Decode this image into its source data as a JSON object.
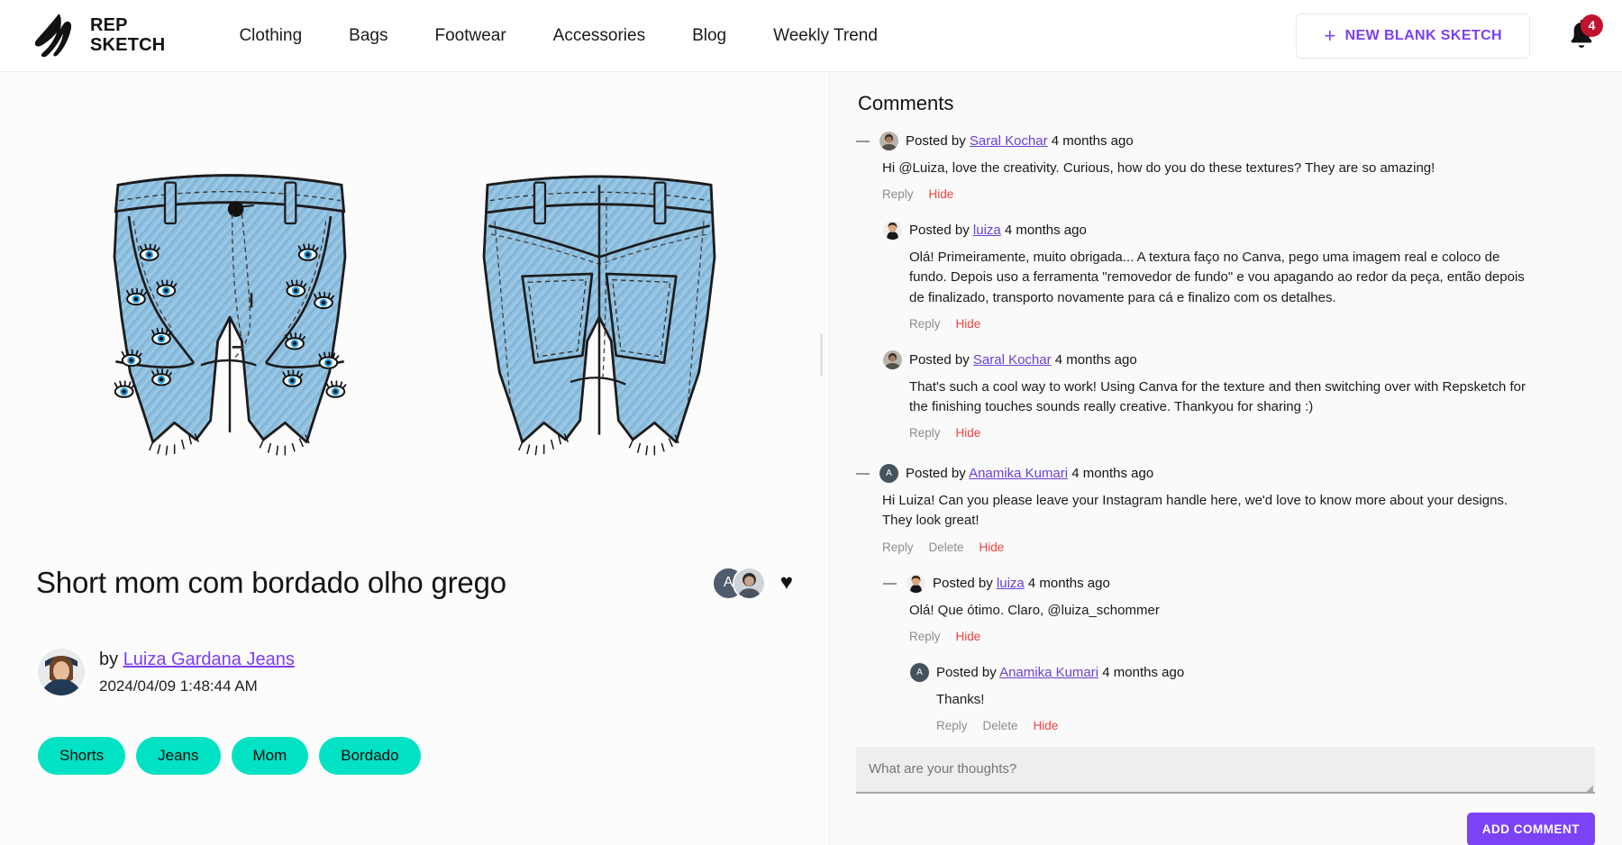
{
  "header": {
    "brand_line1": "REP",
    "brand_line2": "SKETCH",
    "logo_icon": "repsketch-logo-icon",
    "nav": [
      {
        "label": "Clothing"
      },
      {
        "label": "Bags"
      },
      {
        "label": "Footwear"
      },
      {
        "label": "Accessories"
      },
      {
        "label": "Blog"
      },
      {
        "label": "Weekly Trend"
      }
    ],
    "new_sketch_label": "NEW BLANK SKETCH",
    "plus_icon": "plus-icon",
    "bell_icon": "bell-icon",
    "notification_count": "4"
  },
  "sketch": {
    "title": "Short mom com bordado olho grego",
    "by_label": "by",
    "author_name": "Luiza Gardana Jeans",
    "date": "2024/04/09 1:48:44 AM",
    "heart_icon": "heart-icon",
    "viewer_initial": "A",
    "tags": [
      "Shorts",
      "Jeans",
      "Mom",
      "Bordado"
    ],
    "front_view_alt": "denim mom shorts front view with evil eye embroidery",
    "back_view_alt": "denim mom shorts back view with patch pockets"
  },
  "comments": {
    "heading": "Comments",
    "posted_by_label": "Posted by",
    "collapse_icon": "collapse-minus-icon",
    "actions": {
      "reply": "Reply",
      "delete": "Delete",
      "hide": "Hide"
    },
    "items": [
      {
        "author": "Saral Kochar",
        "avatar_type": "photo",
        "time": "4 months ago",
        "text": "Hi @Luiza, love the creativity. Curious, how do you do these textures? They are so amazing!",
        "acts": [
          "Reply",
          "Hide"
        ],
        "collapsible": true,
        "replies": [
          {
            "author": "luiza",
            "avatar_type": "photo",
            "time": "4 months ago",
            "text": "Olá! Primeiramente, muito obrigada... A textura faço no Canva, pego uma imagem real e coloco de fundo. Depois uso a ferramenta \"removedor de fundo\" e vou apagando ao redor da peça, então depois de finalizado, transporto novamente para cá e finalizo com os detalhes.",
            "acts": [
              "Reply",
              "Hide"
            ],
            "collapsible": false,
            "replies": []
          },
          {
            "author": "Saral Kochar",
            "avatar_type": "photo",
            "time": "4 months ago",
            "text": "That's such a cool way to work! Using Canva for the texture and then switching over with Repsketch for the finishing touches sounds really creative. Thankyou for sharing :)",
            "acts": [
              "Reply",
              "Hide"
            ],
            "collapsible": false,
            "replies": []
          }
        ]
      },
      {
        "author": "Anamika Kumari",
        "avatar_type": "initial",
        "initial": "A",
        "time": "4 months ago",
        "text": "Hi Luiza! Can you please leave your Instagram handle here, we'd love to know more about your designs. They look great!",
        "acts": [
          "Reply",
          "Delete",
          "Hide"
        ],
        "collapsible": true,
        "replies": [
          {
            "author": "luiza",
            "avatar_type": "photo",
            "time": "4 months ago",
            "text": "Olá! Que ótimo. Claro, @luiza_schommer",
            "acts": [
              "Reply",
              "Hide"
            ],
            "collapsible": true,
            "replies": [
              {
                "author": "Anamika Kumari",
                "avatar_type": "initial",
                "initial": "A",
                "time": "4 months ago",
                "text": "Thanks!",
                "acts": [
                  "Reply",
                  "Delete",
                  "Hide"
                ],
                "collapsible": false,
                "replies": []
              }
            ]
          }
        ]
      }
    ],
    "composer_placeholder": "What are your thoughts?",
    "composer_value": "",
    "add_comment_label": "ADD COMMENT"
  },
  "colors": {
    "accent_purple": "#7b42f6",
    "tag_teal": "#00e2c3",
    "hide_red": "#f04040",
    "badge_red": "#c0132f",
    "denim_blue": "#8ebfdf"
  }
}
